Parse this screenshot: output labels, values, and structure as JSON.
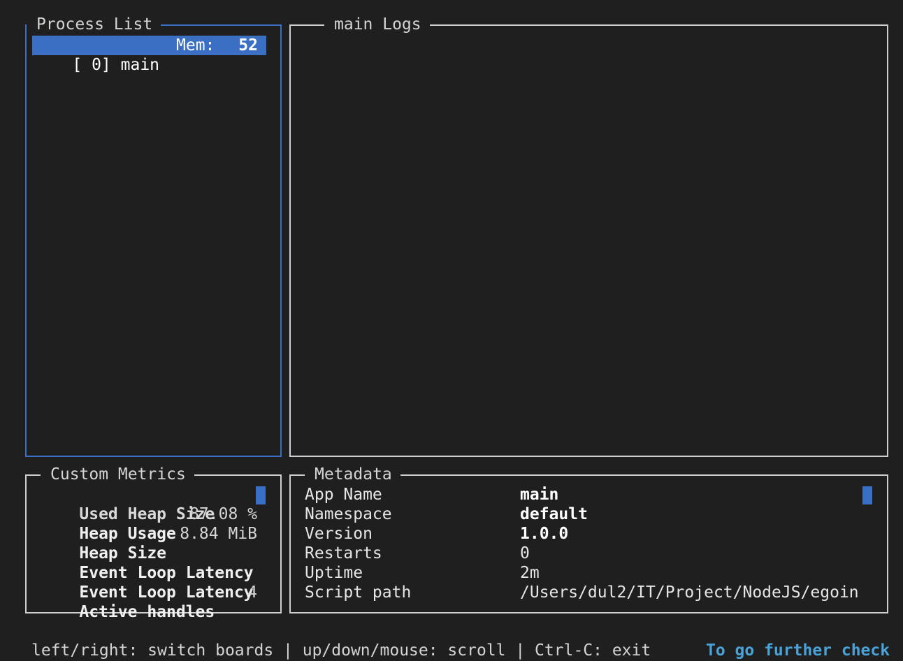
{
  "process_list": {
    "title": "Process List",
    "rows": [
      {
        "id_label": "[ 0] main",
        "mem_label": "Mem:",
        "mem_value": "52"
      }
    ]
  },
  "logs": {
    "title": "main Logs"
  },
  "custom_metrics": {
    "title": "Custom Metrics",
    "rows": [
      {
        "label": "Used Heap Size",
        "value": ""
      },
      {
        "label": "Heap Usage",
        "value": "87.08 %"
      },
      {
        "label": "Heap Size",
        "value": "8.84 MiB"
      },
      {
        "label": "Event Loop Latency",
        "value": ""
      },
      {
        "label": "Event Loop Latency",
        "value": ""
      },
      {
        "label": "Active handles",
        "value": "4"
      }
    ]
  },
  "metadata": {
    "title": "Metadata",
    "rows": [
      {
        "key": "App Name",
        "value": "main"
      },
      {
        "key": "Namespace",
        "value": "default"
      },
      {
        "key": "Version",
        "value": "1.0.0"
      },
      {
        "key": "Restarts",
        "value": "0"
      },
      {
        "key": "Uptime",
        "value": "2m"
      },
      {
        "key": "Script path",
        "value": "/Users/dul2/IT/Project/NodeJS/egoin"
      }
    ]
  },
  "footer": {
    "help": "left/right: switch boards | up/down/mouse: scroll | Ctrl-C: exit",
    "link": "To go further check"
  },
  "colors": {
    "background": "#1f1f1f",
    "accent": "#3a6fc4",
    "link": "#4aa3d8"
  }
}
